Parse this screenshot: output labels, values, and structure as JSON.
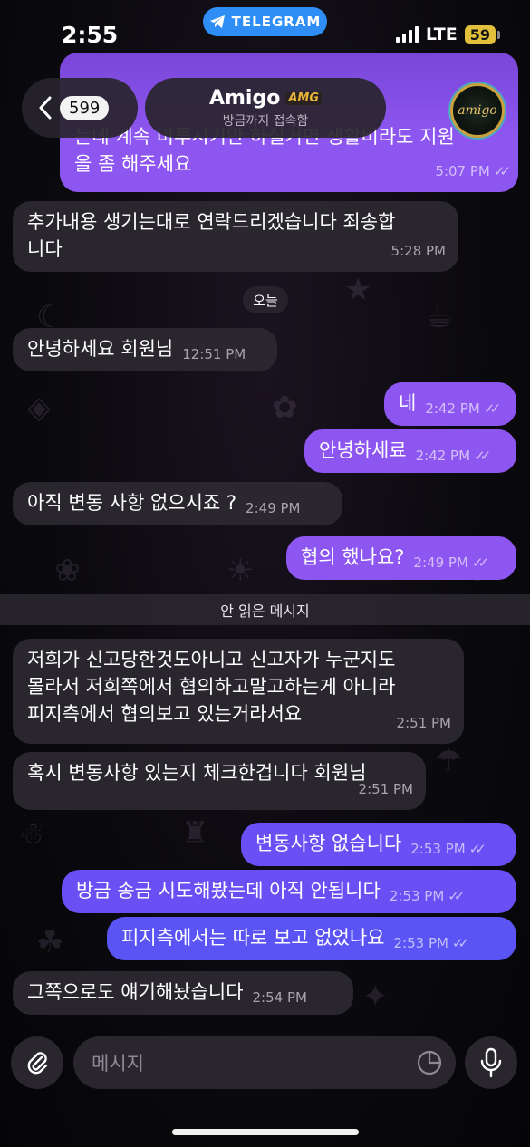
{
  "status": {
    "time": "2:55",
    "app_pill": "TELEGRAM",
    "network": "LTE",
    "battery": "59"
  },
  "header": {
    "back_count": "599",
    "title": "Amigo",
    "title_tag": "AMG",
    "subtitle": "방금까지 접속함",
    "avatar_text": "amigo"
  },
  "messages": [
    {
      "id": "m0",
      "dir": "out",
      "text": "는데 계속 미루시기만 하실거면 생활비라도 지원\n을 좀 해주세요",
      "time": "5:07 PM",
      "read": true
    },
    {
      "id": "m1",
      "dir": "in",
      "text": "추가내용 생기는대로 연락드리겠습니다 죄송합\n니다",
      "time": "5:28 PM"
    },
    {
      "id": "m2",
      "dir": "in",
      "text": "안녕하세요 회원님",
      "time": "12:51 PM"
    },
    {
      "id": "m3",
      "dir": "out",
      "text": "네",
      "time": "2:42 PM",
      "read": true
    },
    {
      "id": "m4",
      "dir": "out",
      "text": "안녕하세료",
      "time": "2:42 PM",
      "read": true
    },
    {
      "id": "m5",
      "dir": "in",
      "text": "아직 변동 사항 없으시죠 ?",
      "time": "2:49 PM"
    },
    {
      "id": "m6",
      "dir": "out",
      "text": "협의 했나요?",
      "time": "2:49 PM",
      "read": true
    },
    {
      "id": "m7",
      "dir": "in",
      "text": "저희가 신고당한것도아니고 신고자가 누군지도\n몰라서 저희쪽에서 협의하고말고하는게 아니라\n피지측에서 협의보고 있는거라서요",
      "time": "2:51 PM"
    },
    {
      "id": "m8",
      "dir": "in",
      "text": "혹시 변동사항 있는지 체크한겁니다 회원님",
      "time": "2:51 PM"
    },
    {
      "id": "m9",
      "dir": "out",
      "text": "변동사항 없습니다",
      "time": "2:53 PM",
      "read": true
    },
    {
      "id": "m10",
      "dir": "out",
      "text": "방금 송금 시도해봤는데 아직 안됩니다",
      "time": "2:53 PM",
      "read": true
    },
    {
      "id": "m11",
      "dir": "out",
      "text": "피지측에서는 따로 보고 없었나요",
      "time": "2:53 PM",
      "read": true
    },
    {
      "id": "m12",
      "dir": "in",
      "text": "그쪽으로도 얘기해놨습니다",
      "time": "2:54 PM"
    }
  ],
  "date_separator": "오늘",
  "unread_separator": "안 읽은 메시지",
  "input": {
    "placeholder": "메시지"
  },
  "colors": {
    "outgoing_bubble": "#8d56f0",
    "incoming_bubble": "#2c2830",
    "telegram_blue": "#2f8ef5",
    "battery": "#e2c03c"
  }
}
